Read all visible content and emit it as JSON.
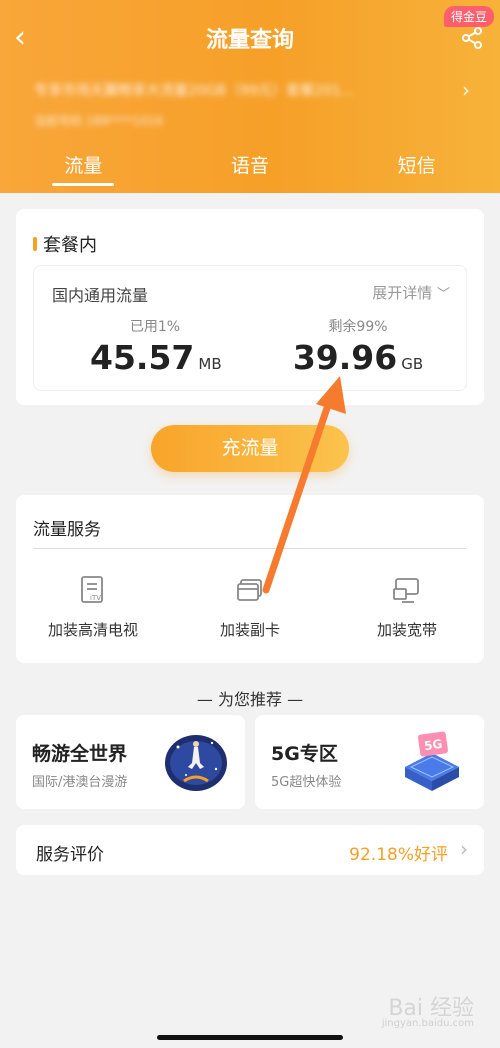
{
  "header": {
    "back_icon": "back-chevron-icon",
    "title": "流量查询",
    "share_icon": "share-icon",
    "coin_badge": "得金豆",
    "plan_text": "专享市场天翼畅享大流量20GB（99元）套餐201...",
    "phone_text": "当前号码 189****1016"
  },
  "tabs": [
    {
      "label": "流量",
      "active": true
    },
    {
      "label": "语音",
      "active": false
    },
    {
      "label": "短信",
      "active": false
    }
  ],
  "package": {
    "section_title": "套餐内",
    "inner_title": "国内通用流量",
    "expand_label": "展开详情",
    "used": {
      "label": "已用1%",
      "value": "45.57",
      "unit": "MB"
    },
    "remaining": {
      "label": "剩余99%",
      "value": "39.96",
      "unit": "GB"
    }
  },
  "recharge_label": "充流量",
  "services": {
    "title": "流量服务",
    "items": [
      {
        "label": "加装高清电视",
        "icon": "itv-icon"
      },
      {
        "label": "加装副卡",
        "icon": "sim-card-icon"
      },
      {
        "label": "加装宽带",
        "icon": "broadband-icon"
      }
    ]
  },
  "recommend": {
    "title": "— 为您推荐 —",
    "cards": [
      {
        "title": "畅游全世界",
        "subtitle": "国际/港澳台漫游",
        "icon": "world-travel-icon"
      },
      {
        "title": "5G专区",
        "subtitle": "5G超快体验",
        "icon": "5g-icon"
      }
    ]
  },
  "review": {
    "label": "服务评价",
    "value": "92.18%好评"
  },
  "watermark": {
    "text": "Bai 经验",
    "sub": "jingyan.baidu.com"
  },
  "colors": {
    "accent": "#f6a028",
    "annotation_arrow": "#f77b2e"
  }
}
